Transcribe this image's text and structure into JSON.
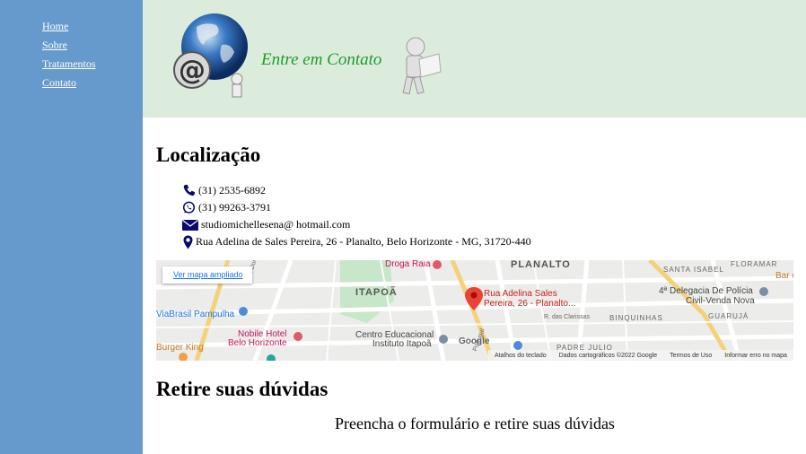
{
  "nav": {
    "items": [
      {
        "label": "Home"
      },
      {
        "label": "Sobre"
      },
      {
        "label": "Tratamentos"
      },
      {
        "label": "Contato"
      }
    ]
  },
  "banner": {
    "title": "Entre em Contato"
  },
  "location": {
    "title": "Localização",
    "phone": "(31) 2535-6892",
    "whatsapp": "(31) 99263-3791",
    "email": "studiomichellesena@ hotmail.com",
    "address": "Rua Adelina de Sales Pereira, 26 - Planalto, Belo Horizonte - MG, 31720-440"
  },
  "map": {
    "view_larger": "Ver mapa ampliado",
    "pin_label_1": "Rua Adelina Sales",
    "pin_label_2": "Pereira, 26 - Planalto...",
    "labels": {
      "droga_raia": "Droga Raia",
      "planalto": "PLANALTO",
      "santa_isabel": "SANTA ISABEL",
      "floramar": "FLORAMAR",
      "bar": "Bar c",
      "itapoa": "ITAPOÃ",
      "delegacia_1": "4ª Delegacia De Polícia",
      "delegacia_2": "Civil-Venda Nova",
      "guaruja": "GUARUJÁ",
      "binquinhas": "BINQUINHAS",
      "clarissas": "R. das Clarissas",
      "via_brasil": "ViaBrasil Pampulha",
      "nobile_1": "Nobile Hotel",
      "nobile_2": "Belo Horizonte",
      "centro_1": "Centro Educacional",
      "centro_2": "Instituto Itapoã",
      "padre_julio": "PADRE JULIO",
      "burger": "Burger King",
      "av_dom": "Av. Dom P",
      "portugal": "Portugal",
      "google": "Google"
    },
    "footer": {
      "shortcuts": "Atalhos do teclado",
      "data": "Dados cartográficos ©2022 Google",
      "terms": "Termos de Uso",
      "report": "Informar erro no mapa"
    }
  },
  "doubts": {
    "title": "Retire suas dúvidas",
    "subtitle": "Preencha o formulário e retire suas dúvidas"
  },
  "colors": {
    "sidebar": "#6699cc",
    "banner": "#dcecdc",
    "banner_title": "#1e9a2c",
    "icon": "#0a0a6e",
    "map_pin": "#ea4335"
  }
}
